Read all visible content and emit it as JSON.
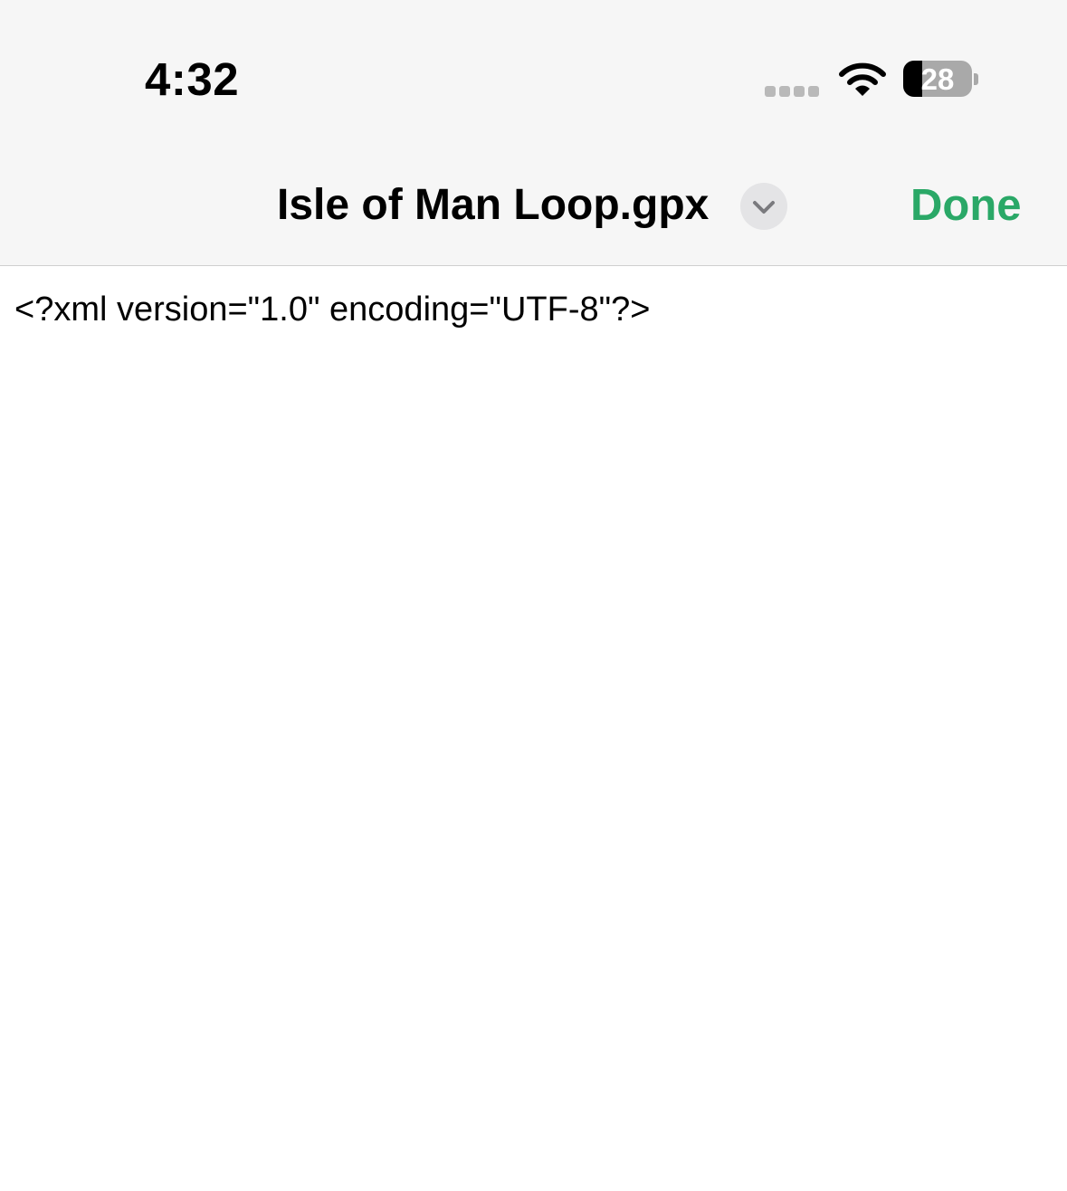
{
  "status_bar": {
    "time": "4:32",
    "signal_icon": "cellular-signal-icon",
    "wifi_icon": "wifi-icon",
    "battery_icon": "battery-icon",
    "battery_level_text": "28",
    "battery_level_fraction": 0.28
  },
  "nav_bar": {
    "title": "Isle of Man Loop.gpx",
    "title_menu_icon": "chevron-down-icon",
    "done_label": "Done"
  },
  "document": {
    "lines": [
      "<?xml version=\"1.0\" encoding=\"UTF-8\"?>"
    ]
  },
  "colors": {
    "accent": "#2aa867",
    "header_background": "#f6f6f6",
    "text": "#000000"
  }
}
